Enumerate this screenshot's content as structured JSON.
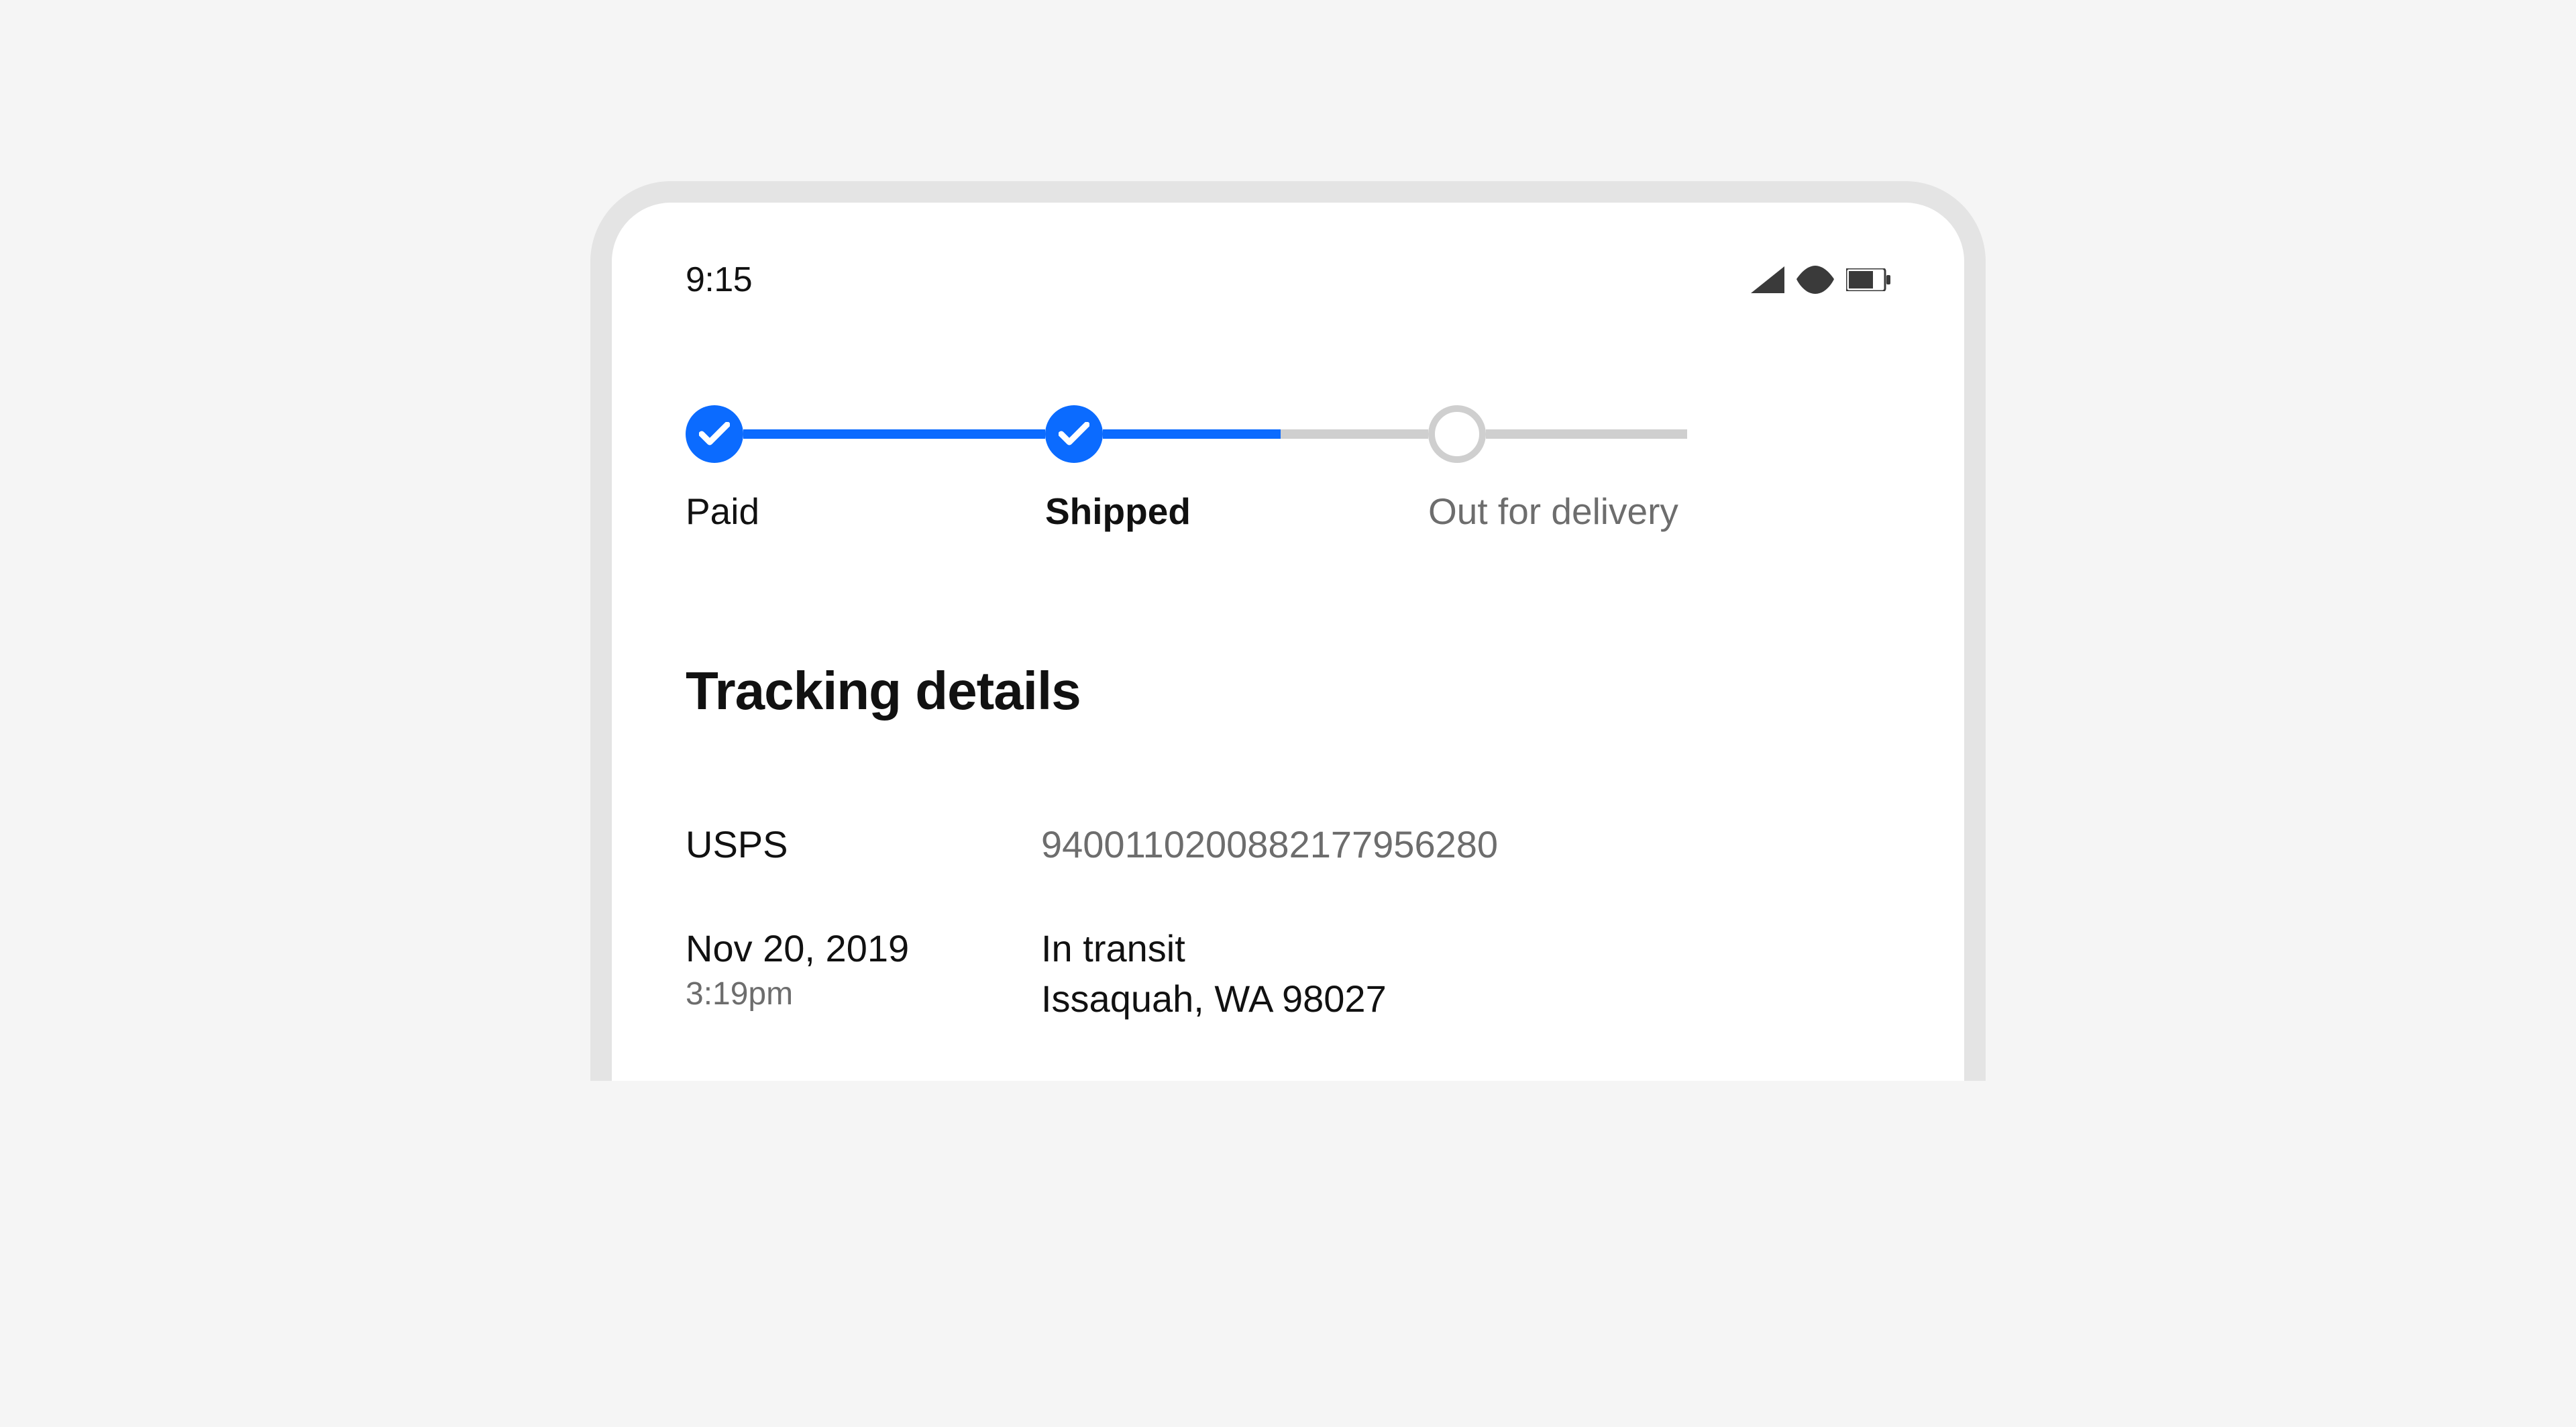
{
  "status_bar": {
    "time": "9:15"
  },
  "stepper": {
    "steps": [
      {
        "label": "Paid",
        "state": "done"
      },
      {
        "label": "Shipped",
        "state": "current"
      },
      {
        "label": "Out for delivery",
        "state": "pending"
      }
    ]
  },
  "tracking": {
    "section_title": "Tracking details",
    "carrier": "USPS",
    "tracking_number": "9400110200882177956280",
    "event": {
      "date": "Nov 20, 2019",
      "time": "3:19pm",
      "status": "In transit",
      "location": "Issaquah, WA 98027"
    }
  }
}
